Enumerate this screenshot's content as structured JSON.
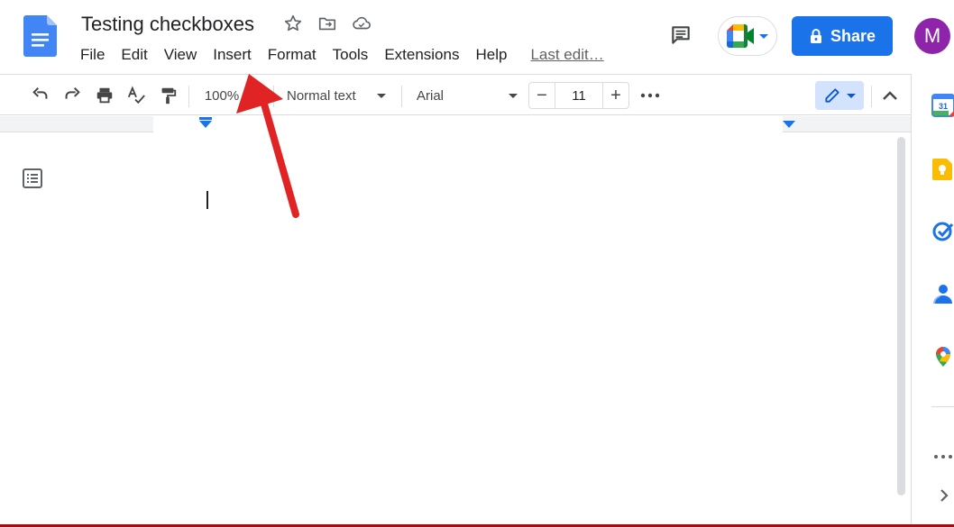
{
  "header": {
    "title": "Testing checkboxes",
    "menu": [
      "File",
      "Edit",
      "View",
      "Insert",
      "Format",
      "Tools",
      "Extensions",
      "Help"
    ],
    "last_edit": "Last edit…",
    "share_label": "Share",
    "avatar_initial": "M"
  },
  "toolbar": {
    "zoom": "100%",
    "style": "Normal text",
    "font": "Arial",
    "font_size": "11"
  },
  "side_panel": {
    "calendar_day": "31"
  },
  "colors": {
    "accent": "#1a73e8",
    "avatar": "#8e24aa",
    "annotation_arrow": "#e02424"
  },
  "icons": [
    "docs-logo-icon",
    "star-icon",
    "move-folder-icon",
    "cloud-status-icon",
    "comment-icon",
    "meet-icon",
    "lock-icon",
    "undo-icon",
    "redo-icon",
    "print-icon",
    "spellcheck-icon",
    "paint-format-icon",
    "more-icon",
    "pencil-icon",
    "collapse-icon",
    "outline-icon",
    "calendar-icon",
    "keep-icon",
    "tasks-icon",
    "contacts-icon",
    "maps-icon",
    "expand-panel-icon"
  ]
}
